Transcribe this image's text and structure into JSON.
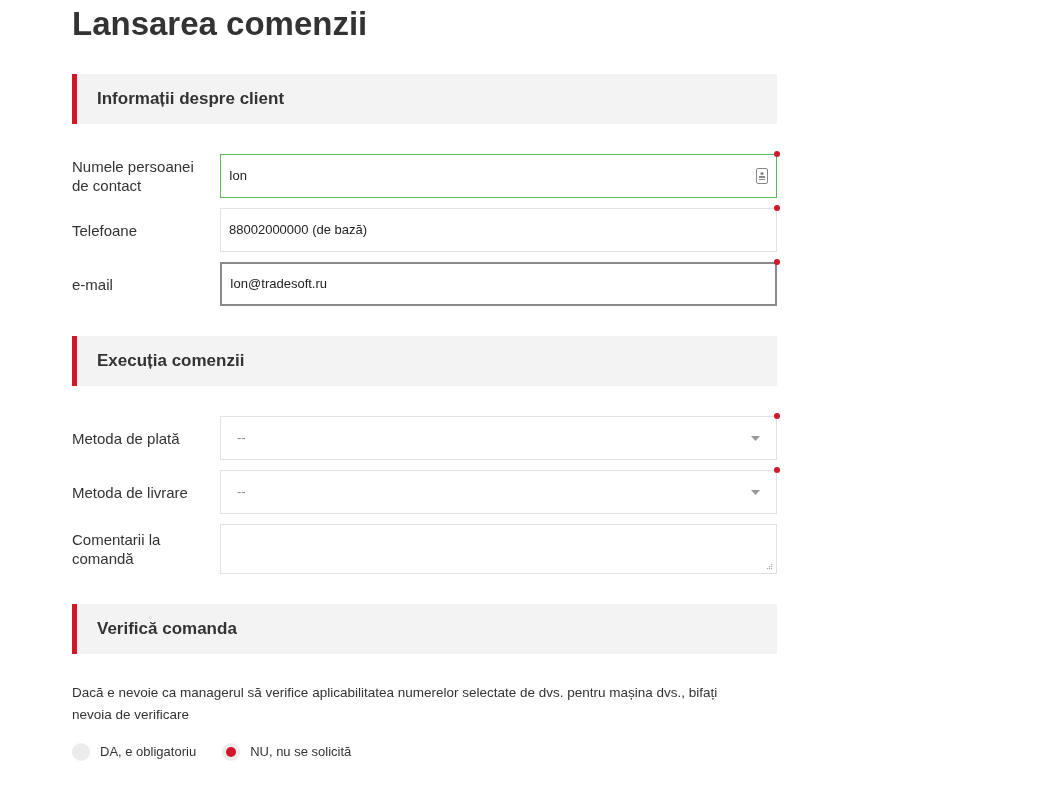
{
  "title": "Lansarea comenzii",
  "sections": [
    {
      "heading": "Informații despre client",
      "fields": [
        {
          "label": "Numele persoanei de contact",
          "kind": "contact",
          "value": "Ion",
          "required": true,
          "valid": true,
          "focused": false
        },
        {
          "label": "Telefoane",
          "kind": "text",
          "value": "88002000000 (de bază)",
          "required": true,
          "valid": false,
          "focused": false
        },
        {
          "label": "e-mail",
          "kind": "text",
          "value": "Ion@tradesoft.ru",
          "required": true,
          "valid": false,
          "focused": true
        }
      ]
    },
    {
      "heading": "Execuția comenzii",
      "fields": [
        {
          "label": "Metoda de plată",
          "kind": "select",
          "placeholder": "--",
          "required": true,
          "valid": false,
          "focused": false
        },
        {
          "label": "Metoda de livrare",
          "kind": "select",
          "placeholder": "--",
          "required": true,
          "valid": false,
          "focused": false
        },
        {
          "label": "Comentarii la comandă",
          "kind": "textarea",
          "required": false,
          "valid": false,
          "focused": false
        }
      ]
    },
    {
      "heading": "Verifică comanda",
      "note": "Dacă e nevoie ca managerul să verifice aplicabilitatea numerelor selectate de dvs. pentru mașina dvs., bifați nevoia de verificare",
      "options": [
        {
          "label": "DA, e obligatoriu",
          "selected": false
        },
        {
          "label": "NU, nu se solicită",
          "selected": true
        }
      ]
    }
  ]
}
